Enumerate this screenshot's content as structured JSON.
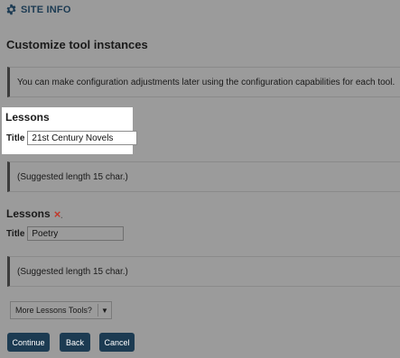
{
  "header": {
    "title": "SITE INFO",
    "icon": "gear-icon"
  },
  "page_title": "Customize tool instances",
  "intro_note": "You can make configuration adjustments later using the configuration capabilities for each tool.",
  "tools": [
    {
      "heading": "Lessons",
      "title_label": "Title",
      "title_value": "21st Century Novels",
      "note": "(Suggested length 15 char.)"
    },
    {
      "heading": "Lessons",
      "remove_icon": "×",
      "title_label": "Title",
      "title_value": "Poetry",
      "note": "(Suggested length 15 char.)"
    }
  ],
  "more_tools": {
    "label": "More Lessons Tools?",
    "caret": "▼"
  },
  "buttons": {
    "continue": "Continue",
    "back": "Back",
    "cancel": "Cancel"
  },
  "colors": {
    "accent": "#1c3b52",
    "remove": "#c0392b",
    "background": "#9b9b9b"
  }
}
